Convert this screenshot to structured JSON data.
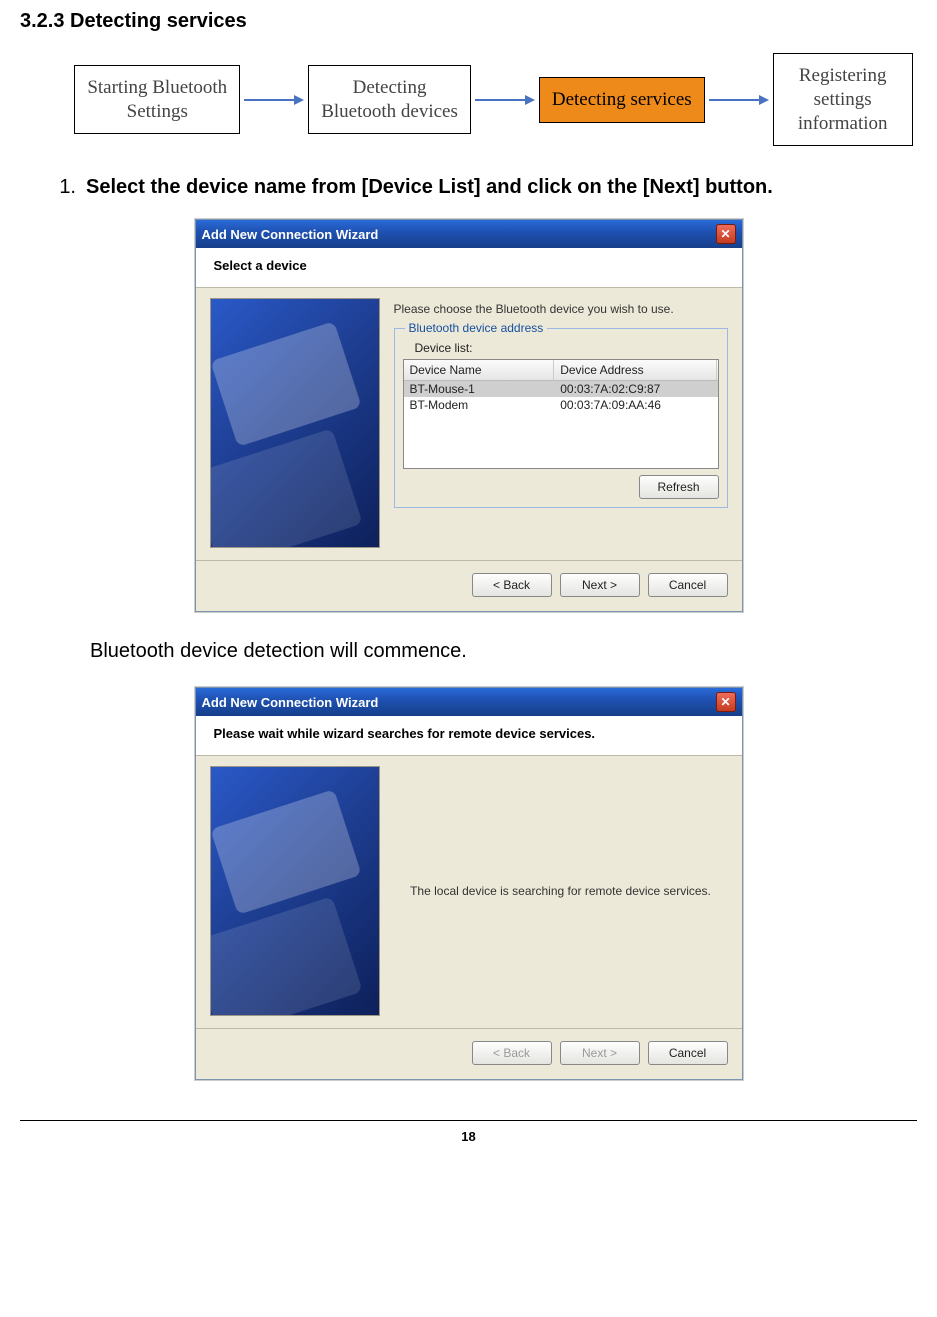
{
  "heading": "3.2.3    Detecting services",
  "flow": {
    "steps": [
      {
        "label": "Starting Bluetooth\nSettings"
      },
      {
        "label": "Detecting\nBluetooth devices"
      },
      {
        "label": "Detecting services",
        "active": true
      },
      {
        "label": "Registering\nsettings\ninformation"
      }
    ]
  },
  "step1": {
    "num": "1.",
    "text": "Select the device name from [Device List] and click on the [Next] button."
  },
  "wizard1": {
    "title": "Add New Connection Wizard",
    "banner": "Select a device",
    "intro": "Please choose the Bluetooth device you wish to use.",
    "group_legend": "Bluetooth device address",
    "device_list_label": "Device list:",
    "columns": {
      "name": "Device Name",
      "addr": "Device Address"
    },
    "rows": [
      {
        "name": "BT-Mouse-1",
        "addr": "00:03:7A:02:C9:87",
        "selected": true
      },
      {
        "name": "BT-Modem",
        "addr": "00:03:7A:09:AA:46",
        "selected": false
      }
    ],
    "refresh_label": "Refresh",
    "back_label": "< Back",
    "next_label": "Next >",
    "cancel_label": "Cancel"
  },
  "between_text": "Bluetooth device detection will commence.",
  "wizard2": {
    "title": "Add New Connection Wizard",
    "banner": "Please wait while wizard searches for remote device services.",
    "message": "The local device is searching for remote device services.",
    "back_label": "< Back",
    "next_label": "Next >",
    "cancel_label": "Cancel"
  },
  "page_number": "18"
}
